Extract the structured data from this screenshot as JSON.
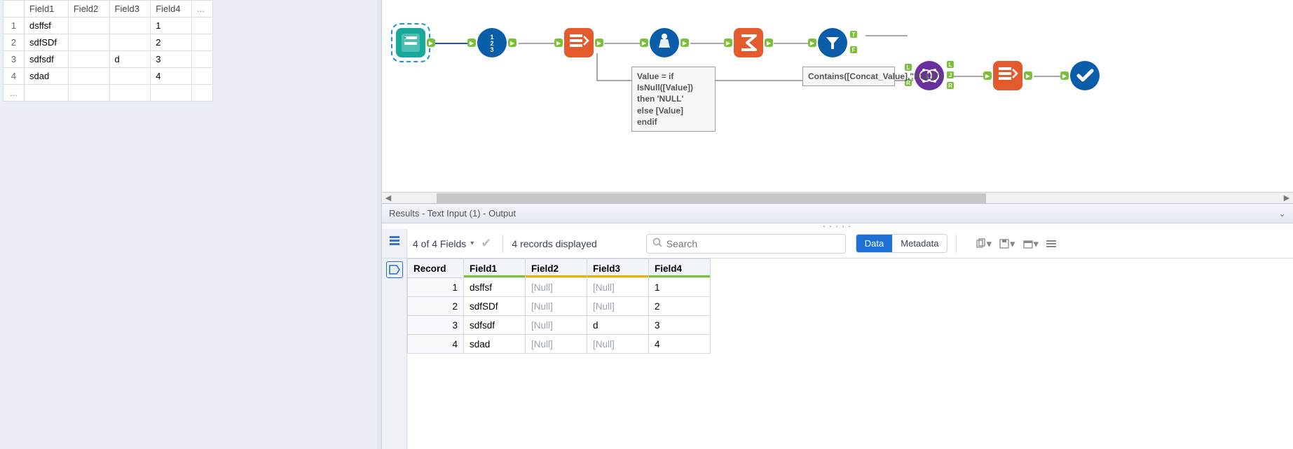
{
  "config_grid": {
    "headers": [
      "Field1",
      "Field2",
      "Field3",
      "Field4"
    ],
    "rows": [
      {
        "n": "1",
        "c": [
          "dsffsf",
          "",
          "",
          "1"
        ]
      },
      {
        "n": "2",
        "c": [
          "sdfSDf",
          "",
          "",
          "2"
        ]
      },
      {
        "n": "3",
        "c": [
          "sdfsdf",
          "",
          "d",
          "3"
        ]
      },
      {
        "n": "4",
        "c": [
          "sdad",
          "",
          "",
          "4"
        ]
      }
    ],
    "ellipsis": "..."
  },
  "workflow": {
    "formula_annot": "Value = if IsNull([Value])\nthen 'NULL'\nelse [Value]\nendif",
    "filter_annot": "Contains([Concat_Value],\"NULL\")"
  },
  "results": {
    "title": "Results - Text Input (1) - Output",
    "fields_summary": "4 of 4 Fields",
    "records_summary": "4 records displayed",
    "search_placeholder": "Search",
    "tab_data": "Data",
    "tab_metadata": "Metadata",
    "columns": [
      "Record",
      "Field1",
      "Field2",
      "Field3",
      "Field4"
    ],
    "null_label": "[Null]",
    "rows": [
      {
        "r": "1",
        "v": [
          "dsffsf",
          null,
          null,
          "1"
        ]
      },
      {
        "r": "2",
        "v": [
          "sdfSDf",
          null,
          null,
          "2"
        ]
      },
      {
        "r": "3",
        "v": [
          "sdfsdf",
          null,
          "d",
          "3"
        ]
      },
      {
        "r": "4",
        "v": [
          "sdad",
          null,
          null,
          "4"
        ]
      }
    ],
    "col_colors": [
      "",
      "#7bbf3a",
      "#e6b400",
      "#e6b400",
      "#7bbf3a"
    ]
  }
}
